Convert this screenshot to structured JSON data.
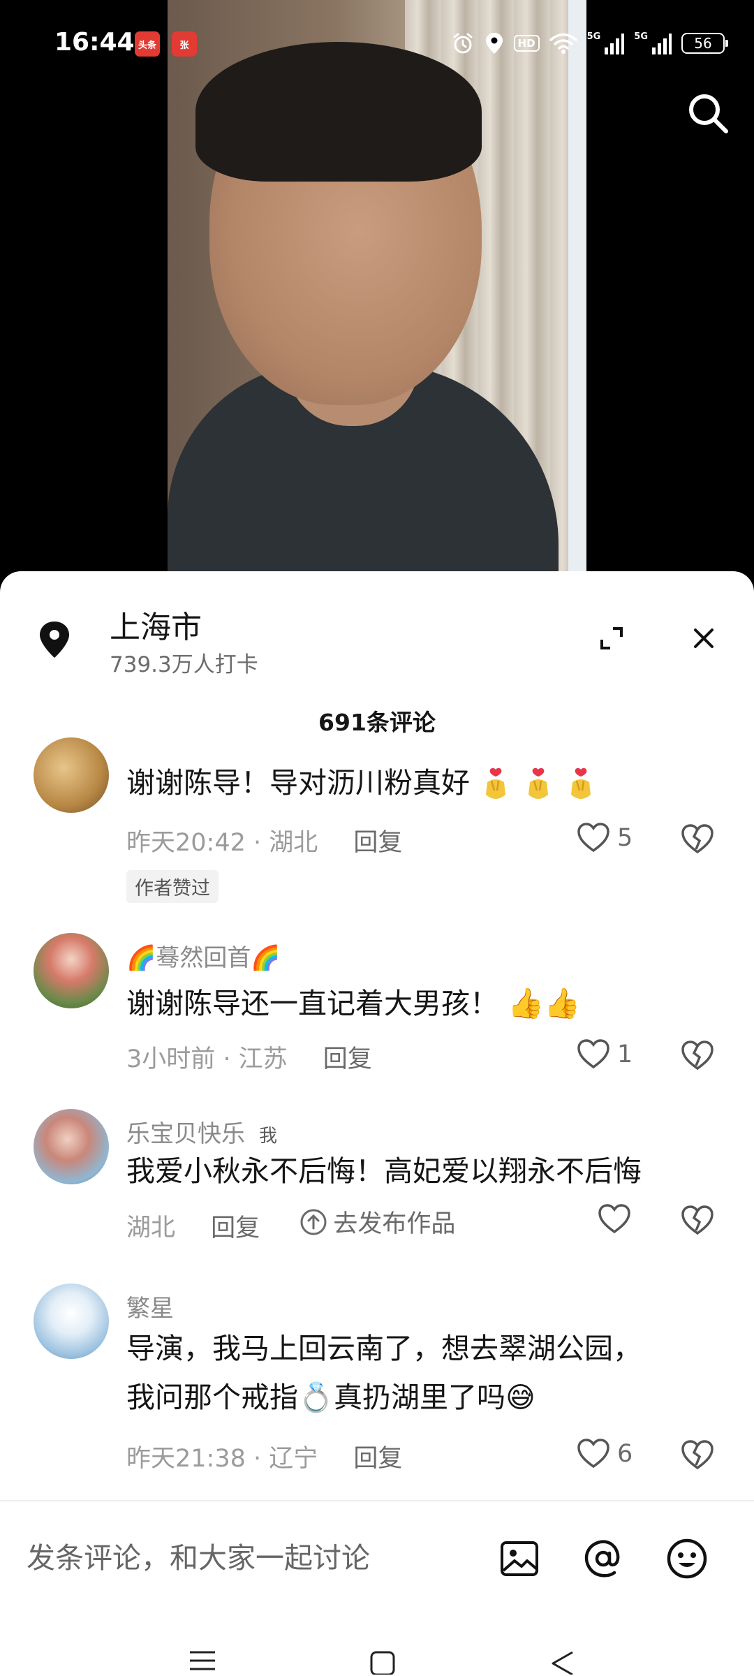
{
  "status_bar": {
    "time": "16:44",
    "badges": [
      "头条",
      "张"
    ],
    "hd": "HD",
    "net1": "5G",
    "net2": "5G",
    "battery": "56"
  },
  "location": {
    "title": "上海市",
    "subtitle": "739.3万人打卡"
  },
  "comments_header": "691条评论",
  "comments": [
    {
      "name": "",
      "text": "谢谢陈导！导对沥川粉真好",
      "time": "昨天20:42 · 湖北",
      "reply": "回复",
      "likes": "5",
      "tag": "作者赞过"
    },
    {
      "name": "蓦然回首",
      "text": "谢谢陈导还一直记着大男孩！",
      "time": "3小时前 · 江苏",
      "reply": "回复",
      "likes": "1"
    },
    {
      "name": "乐宝贝快乐",
      "me_tag": "我",
      "text": "我爱小秋永不后悔！高妃爱以翔永不后悔",
      "time": "湖北",
      "reply": "回复",
      "publish": "去发布作品",
      "likes": ""
    },
    {
      "name": "繁星",
      "text_line1": "导演，我马上回云南了，想去翠湖公园，",
      "text_line2a": "我问那个戒指",
      "text_line2b": "真扔湖里了吗",
      "time": "昨天21:38 · 辽宁",
      "reply": "回复",
      "likes": "6"
    }
  ],
  "input": {
    "placeholder": "发条评论，和大家一起讨论"
  },
  "icons": {
    "search": "search-icon",
    "location": "location-pin-icon",
    "expand": "expand-icon",
    "close": "close-icon",
    "like": "heart-outline-icon",
    "dislike": "broken-heart-icon",
    "image": "image-icon",
    "mention": "at-icon",
    "emoji": "emoji-icon"
  }
}
